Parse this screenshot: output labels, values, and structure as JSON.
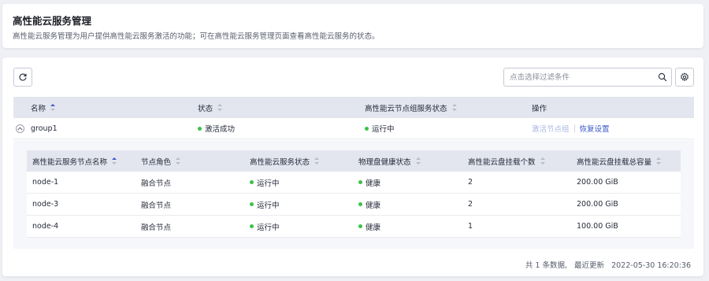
{
  "header": {
    "title": "高性能云服务管理",
    "description": "高性能云服务管理为用户提供高性能云服务激活的功能；可在高性能云服务管理页面查看高性能云服务的状态。"
  },
  "toolbar": {
    "refresh_icon": "refresh-icon",
    "search_placeholder": "点击选择过滤条件",
    "search_icon": "search-icon",
    "settings_icon": "gear-icon"
  },
  "table": {
    "columns": [
      "名称",
      "状态",
      "高性能云节点组服务状态",
      "操作"
    ],
    "rows": [
      {
        "name": "group1",
        "status": "激活成功",
        "group_status": "运行中",
        "actions": [
          "激活节点组",
          "恢复设置"
        ]
      }
    ]
  },
  "nested_table": {
    "columns": [
      "高性能云服务节点名称",
      "节点角色",
      "高性能云服务状态",
      "物理盘健康状态",
      "高性能云盘挂载个数",
      "高性能云盘挂载总容量"
    ],
    "rows": [
      {
        "name": "node-1",
        "role": "融合节点",
        "service_status": "运行中",
        "disk_health": "健康",
        "mount_count": "2",
        "capacity": "200.00 GiB"
      },
      {
        "name": "node-3",
        "role": "融合节点",
        "service_status": "运行中",
        "disk_health": "健康",
        "mount_count": "2",
        "capacity": "200.00 GiB"
      },
      {
        "name": "node-4",
        "role": "融合节点",
        "service_status": "运行中",
        "disk_health": "健康",
        "mount_count": "1",
        "capacity": "100.00 GiB"
      }
    ]
  },
  "footer": {
    "total": "共 1 条数据,",
    "updated_label": "最近更新",
    "updated_time": "2022-05-30 16:20:36"
  },
  "colors": {
    "accent": "#3b5ac8",
    "status_running": "#3ac24b",
    "header_bg": "#e3e6ef"
  }
}
